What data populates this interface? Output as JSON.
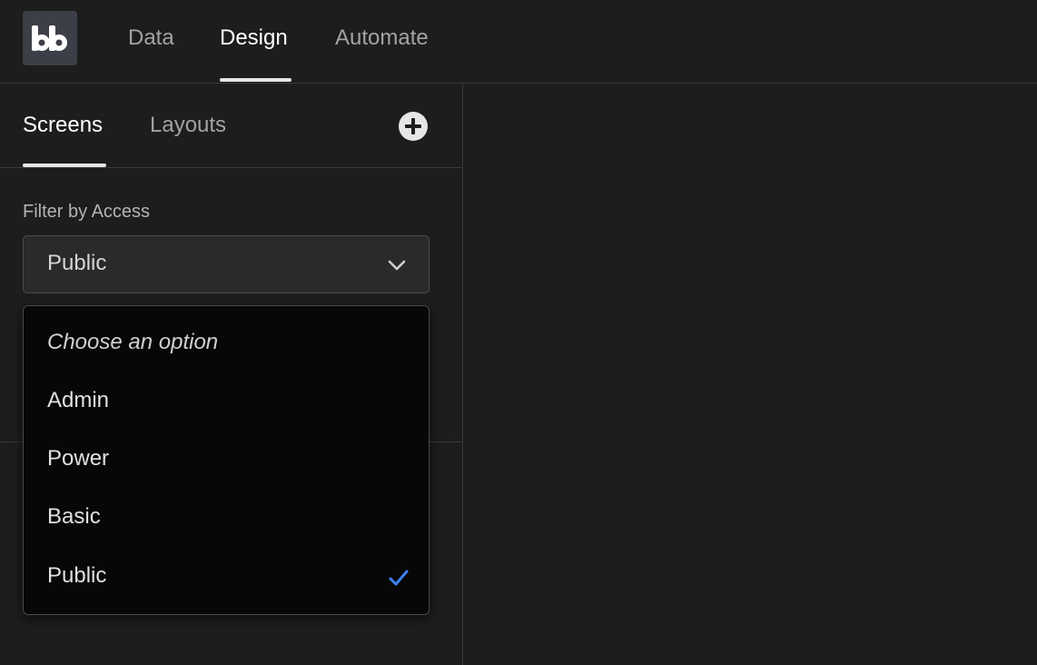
{
  "logo": {
    "text": "bb"
  },
  "nav": {
    "tabs": [
      {
        "label": "Data"
      },
      {
        "label": "Design",
        "active": true
      },
      {
        "label": "Automate"
      }
    ]
  },
  "panel": {
    "tabs": [
      {
        "label": "Screens",
        "active": true
      },
      {
        "label": "Layouts"
      }
    ],
    "add_icon": "plus-circle-icon"
  },
  "filter": {
    "label": "Filter by Access",
    "selected": "Public",
    "placeholder": "Choose an option",
    "options": [
      {
        "label": "Admin"
      },
      {
        "label": "Power"
      },
      {
        "label": "Basic"
      },
      {
        "label": "Public",
        "selected": true
      }
    ]
  },
  "colors": {
    "accent_check": "#3b82f6",
    "background": "#1d1d1d",
    "popover": "#070707"
  }
}
